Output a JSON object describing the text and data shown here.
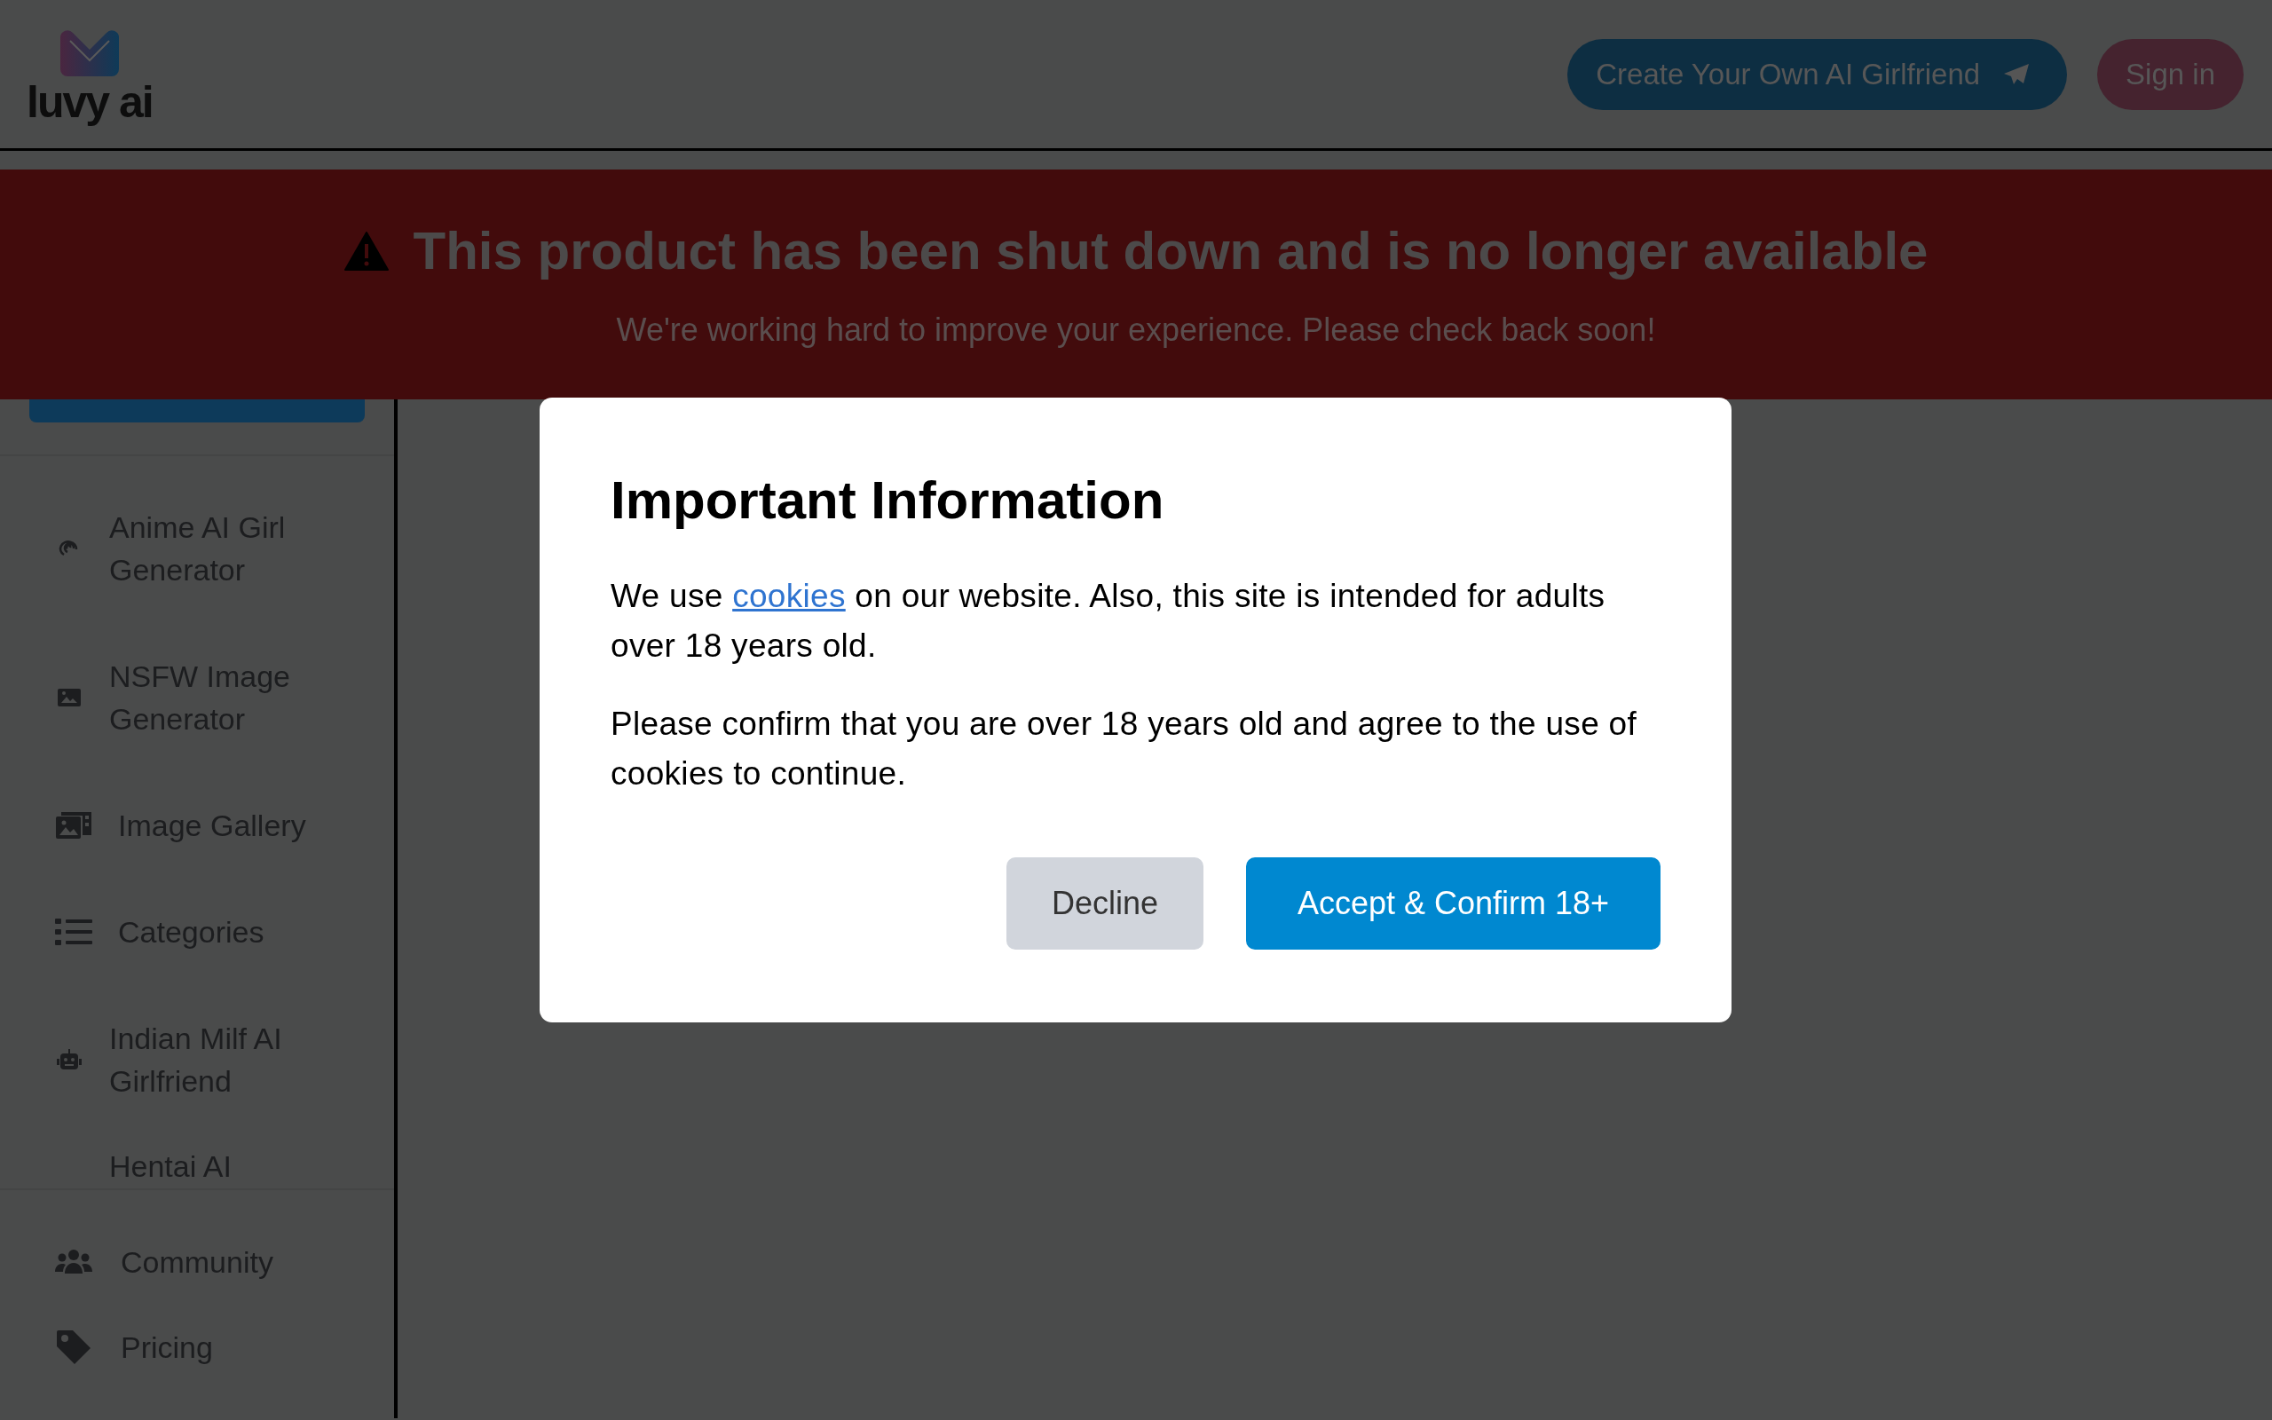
{
  "header": {
    "logo_text": "luvy ai",
    "create_button": "Create Your Own AI Girlfriend",
    "signin_button": "Sign in"
  },
  "banner": {
    "title": "This product has been shut down and is no longer available",
    "subtitle": "We're working hard to improve your experience. Please check back soon!"
  },
  "sidebar": {
    "items": [
      {
        "label": "Anime AI Girl Generator"
      },
      {
        "label": "NSFW Image Generator"
      },
      {
        "label": "Image Gallery"
      },
      {
        "label": "Categories"
      },
      {
        "label": "Indian Milf AI Girlfriend"
      },
      {
        "label": "Hentai AI"
      }
    ],
    "footer_items": [
      {
        "label": "Community"
      },
      {
        "label": "Pricing"
      }
    ]
  },
  "modal": {
    "title": "Important Information",
    "paragraphs": [
      {
        "before": "We use ",
        "link": "cookies",
        "after": " on our website. Also, this site is intended for adults over 18 years old."
      },
      {
        "before": "Please confirm that you are over 18 years old and agree to the use of cookies to continue."
      }
    ],
    "decline_button": "Decline",
    "accept_button": "Accept & Confirm 18+"
  }
}
